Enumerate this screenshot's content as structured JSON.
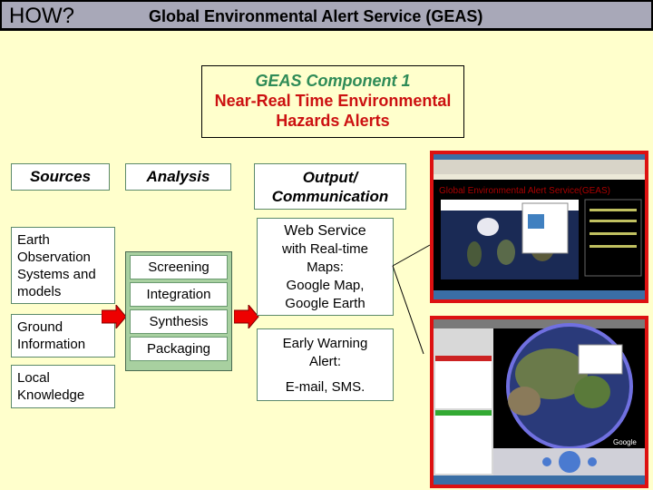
{
  "header": {
    "how": "HOW?",
    "title": "Global Environmental Alert Service (GEAS)"
  },
  "component": {
    "line1": "GEAS Component 1",
    "line2": "Near-Real Time Environmental",
    "line3": "Hazards Alerts"
  },
  "columns": {
    "sources": "Sources",
    "analysis": "Analysis",
    "output_line1": "Output/",
    "output_line2": "Communication"
  },
  "sources": [
    {
      "lines": [
        "Earth",
        "Observation",
        "Systems and",
        "models"
      ]
    },
    {
      "lines": [
        "Ground",
        "Information"
      ]
    },
    {
      "lines": [
        "Local",
        "Knowledge"
      ]
    }
  ],
  "analysis_steps": [
    "Screening",
    "Integration",
    "Synthesis",
    "Packaging"
  ],
  "outputs": {
    "web": [
      "Web Service",
      "with Real-time",
      "Maps:",
      "Google Map,",
      "Google Earth"
    ],
    "alert": [
      "Early Warning",
      "Alert:",
      "E-mail, SMS."
    ]
  },
  "screenshots": {
    "web_title": "Global Environmental Alert Service(GEAS)",
    "earth_brand": "Google"
  },
  "colors": {
    "background": "#ffffcc",
    "header_bg": "#a8a8b8",
    "accent_green": "#2e8b57",
    "accent_red": "#cc1111",
    "arrow": "#ee0000",
    "analysis_bg": "#a8d0a0"
  }
}
